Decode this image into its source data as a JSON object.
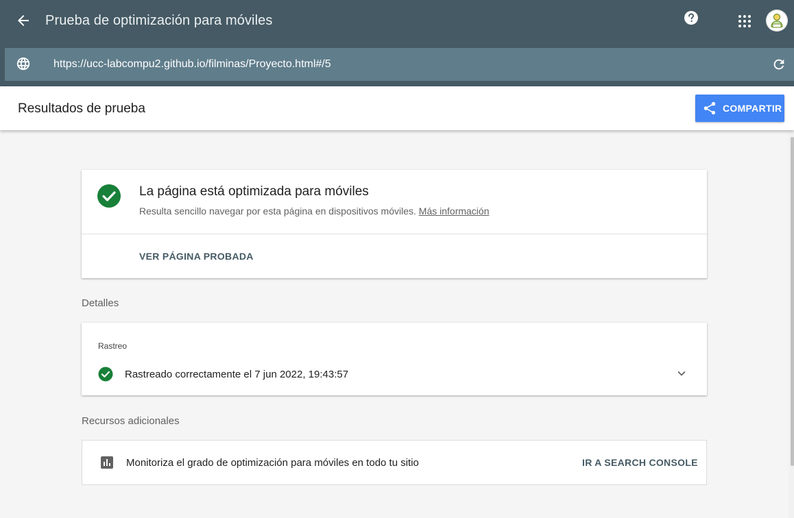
{
  "app": {
    "title": "Prueba de optimización para móviles",
    "icons": {
      "back": "arrow-back-icon",
      "help": "help-icon",
      "apps": "apps-grid-icon",
      "avatar": "user-avatar"
    }
  },
  "url_bar": {
    "url": "https://ucc-labcompu2.github.io/filminas/Proyecto.html#/5",
    "icons": {
      "globe": "globe-icon",
      "reload": "reload-icon"
    }
  },
  "results_header": {
    "title": "Resultados de prueba",
    "share_label": "COMPARTIR"
  },
  "main_result": {
    "heading": "La página está optimizada para móviles",
    "description": "Resulta sencillo navegar por esta página en dispositivos móviles.",
    "more_info_link": "Más información",
    "view_page_button": "VER PÁGINA PROBADA"
  },
  "details": {
    "section_label": "Detalles",
    "crawl": {
      "title": "Rastreo",
      "status": "Rastreado correctamente el 7 jun 2022, 19:43:57"
    }
  },
  "resources": {
    "section_label": "Recursos adicionales",
    "text": "Monitoriza el grado de optimización para móviles en todo tu sitio",
    "button": "IR A SEARCH CONSOLE"
  },
  "colors": {
    "top_bar": "#455a64",
    "url_bar": "#607d8b",
    "share_button": "#4285f4",
    "success_green": "#188038",
    "page_background": "#f5f5f5"
  }
}
